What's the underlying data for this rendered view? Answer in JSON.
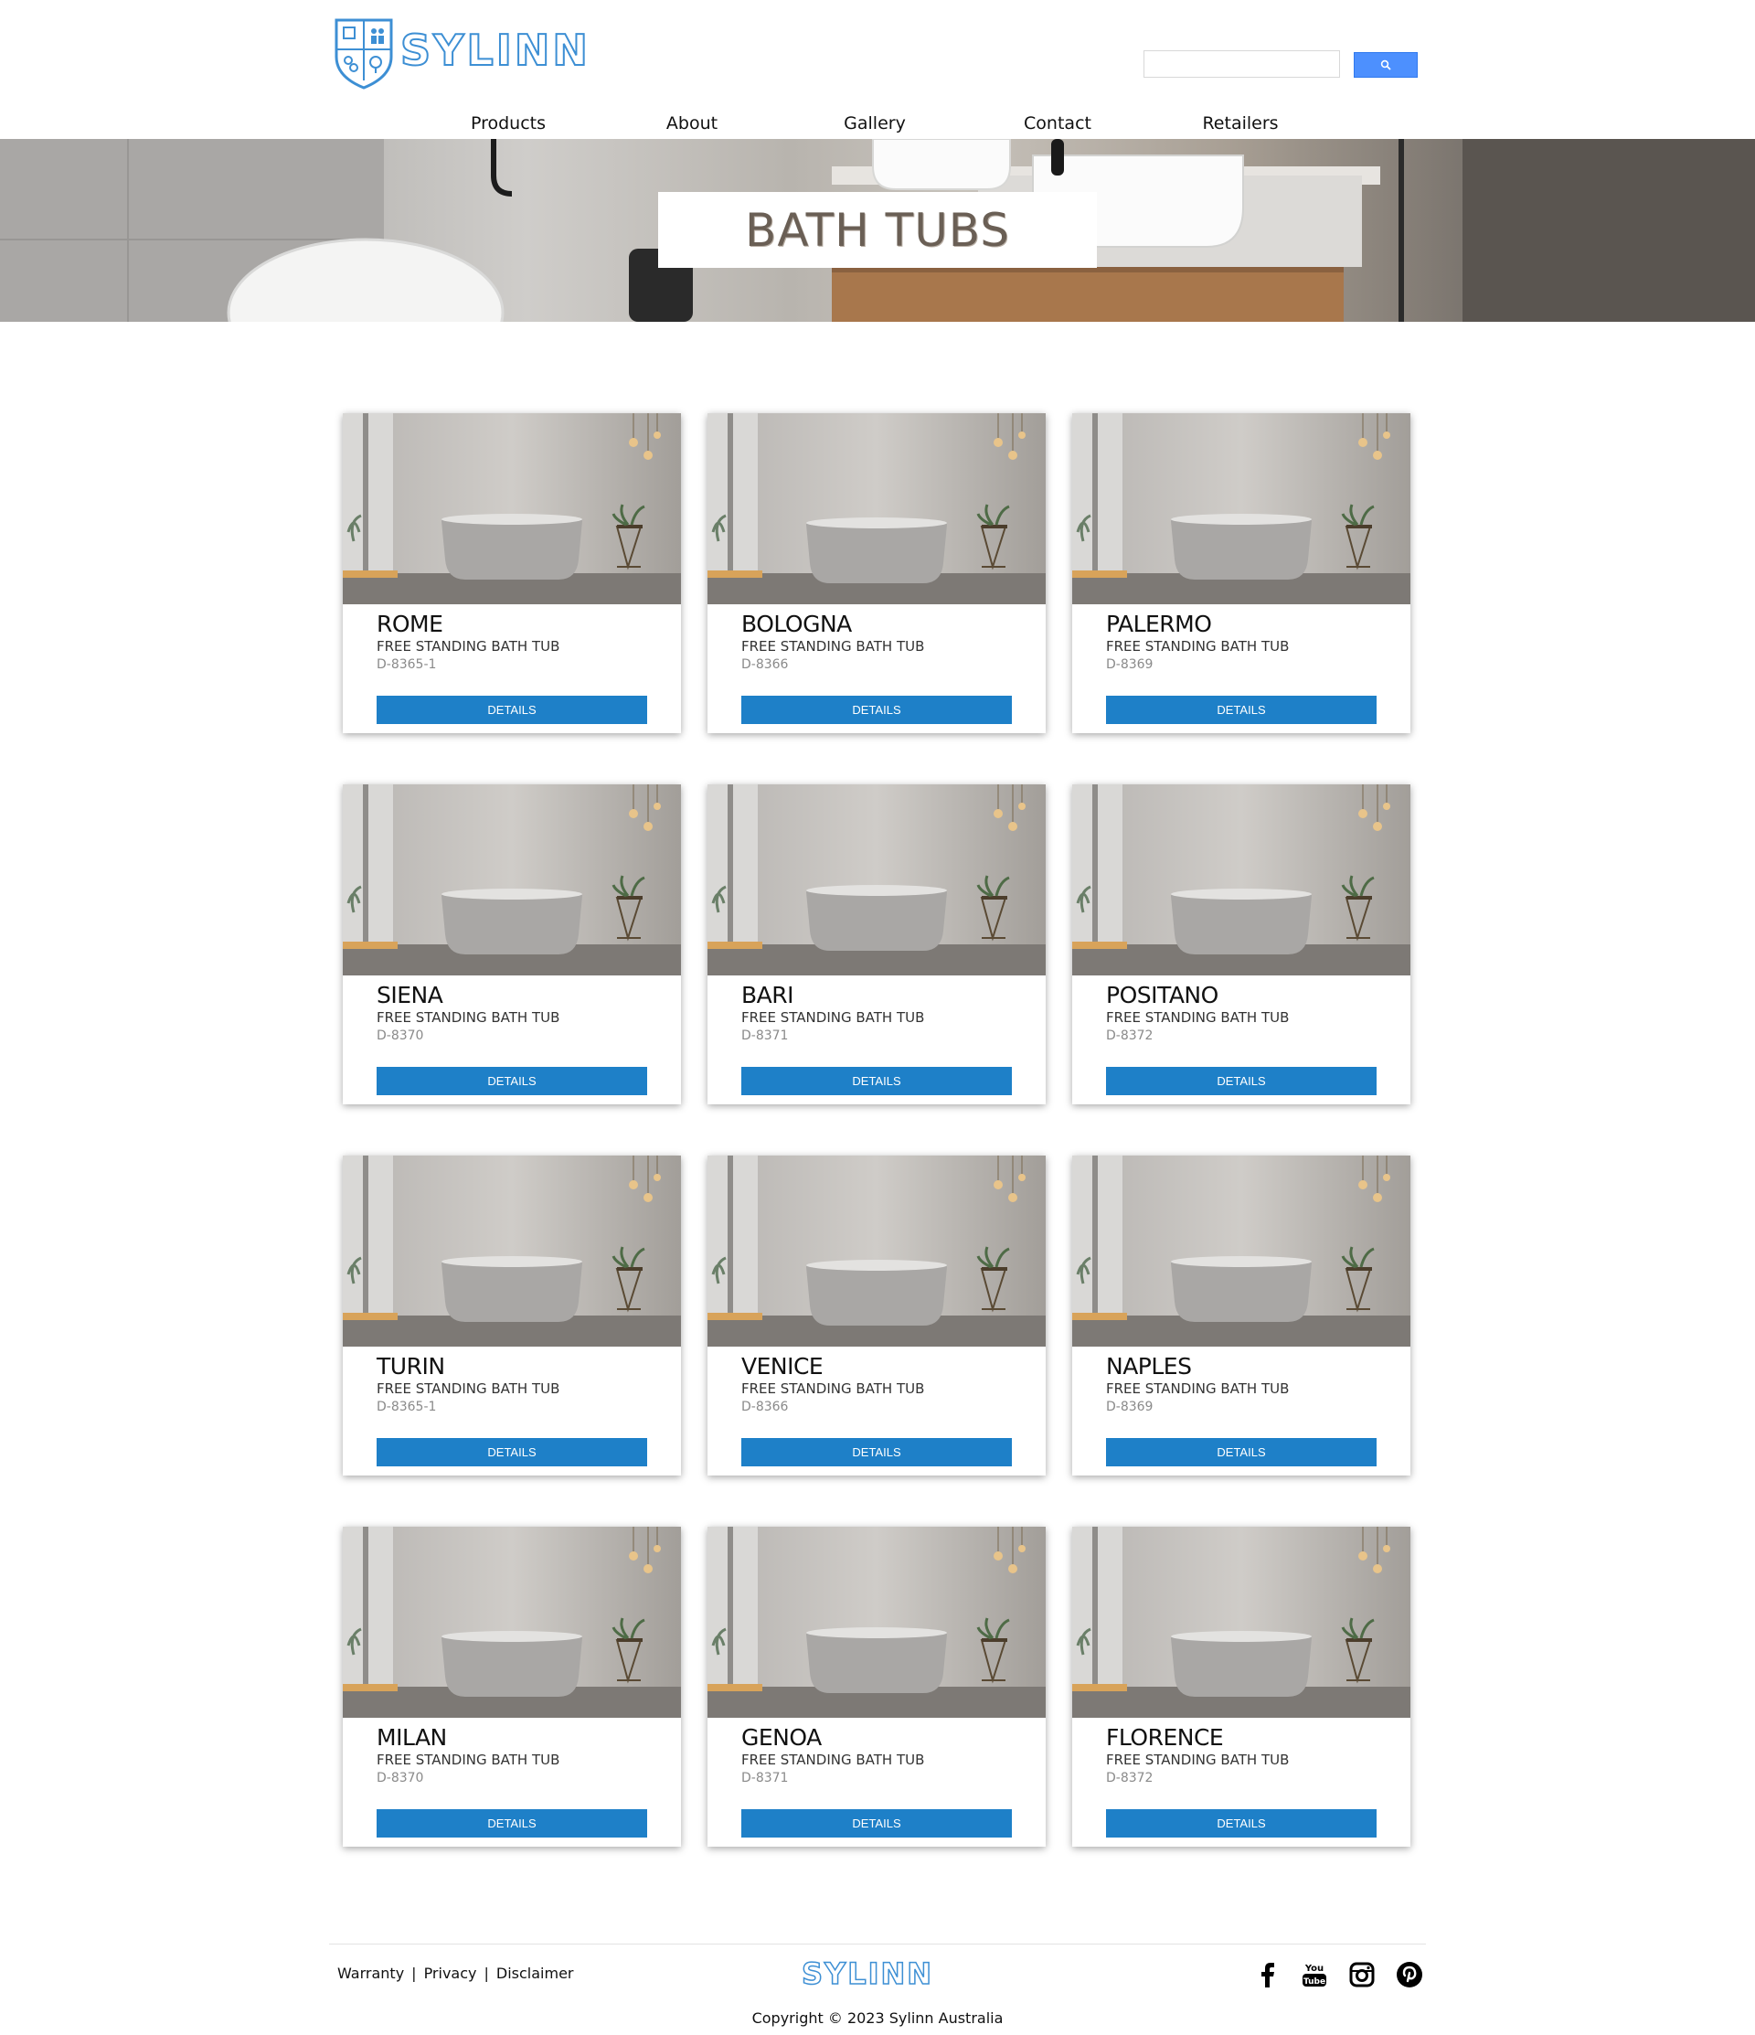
{
  "brand": {
    "logo_text": "SYLINN",
    "accent_color": "#3d8fd4"
  },
  "search": {
    "placeholder": "",
    "button_icon": "search-icon"
  },
  "nav": {
    "items": [
      {
        "label": "Products"
      },
      {
        "label": "About"
      },
      {
        "label": "Gallery"
      },
      {
        "label": "Contact"
      },
      {
        "label": "Retailers"
      }
    ]
  },
  "hero": {
    "title": "BATH TUBS"
  },
  "products": [
    {
      "name": "ROME",
      "type": "FREE STANDING BATH TUB",
      "code": "D-8365-1",
      "button": "DETAILS"
    },
    {
      "name": "BOLOGNA",
      "type": "FREE STANDING BATH TUB",
      "code": "D-8366",
      "button": "DETAILS"
    },
    {
      "name": "PALERMO",
      "type": "FREE STANDING BATH TUB",
      "code": "D-8369",
      "button": "DETAILS"
    },
    {
      "name": "SIENA",
      "type": "FREE STANDING BATH TUB",
      "code": "D-8370",
      "button": "DETAILS"
    },
    {
      "name": "BARI",
      "type": "FREE STANDING BATH TUB",
      "code": "D-8371",
      "button": "DETAILS"
    },
    {
      "name": "POSITANO",
      "type": "FREE STANDING BATH TUB",
      "code": "D-8372",
      "button": "DETAILS"
    },
    {
      "name": "TURIN",
      "type": "FREE STANDING BATH TUB",
      "code": "D-8365-1",
      "button": "DETAILS"
    },
    {
      "name": "VENICE",
      "type": "FREE STANDING BATH TUB",
      "code": "D-8366",
      "button": "DETAILS"
    },
    {
      "name": "NAPLES",
      "type": "FREE STANDING BATH TUB",
      "code": "D-8369",
      "button": "DETAILS"
    },
    {
      "name": "MILAN",
      "type": "FREE STANDING BATH TUB",
      "code": "D-8370",
      "button": "DETAILS"
    },
    {
      "name": "GENOA",
      "type": "FREE STANDING BATH TUB",
      "code": "D-8371",
      "button": "DETAILS"
    },
    {
      "name": "FLORENCE",
      "type": "FREE STANDING BATH TUB",
      "code": "D-8372",
      "button": "DETAILS"
    }
  ],
  "footer": {
    "links": [
      "Warranty",
      "Privacy",
      "Disclaimer"
    ],
    "separator": "|",
    "logo_text": "SYLINN",
    "social": [
      "facebook-icon",
      "youtube-icon",
      "instagram-icon",
      "pinterest-icon"
    ],
    "copyright": "Copyright © 2023 Sylinn Australia"
  },
  "colors": {
    "button_blue": "#1e80c8",
    "search_blue": "#4d90fe"
  }
}
